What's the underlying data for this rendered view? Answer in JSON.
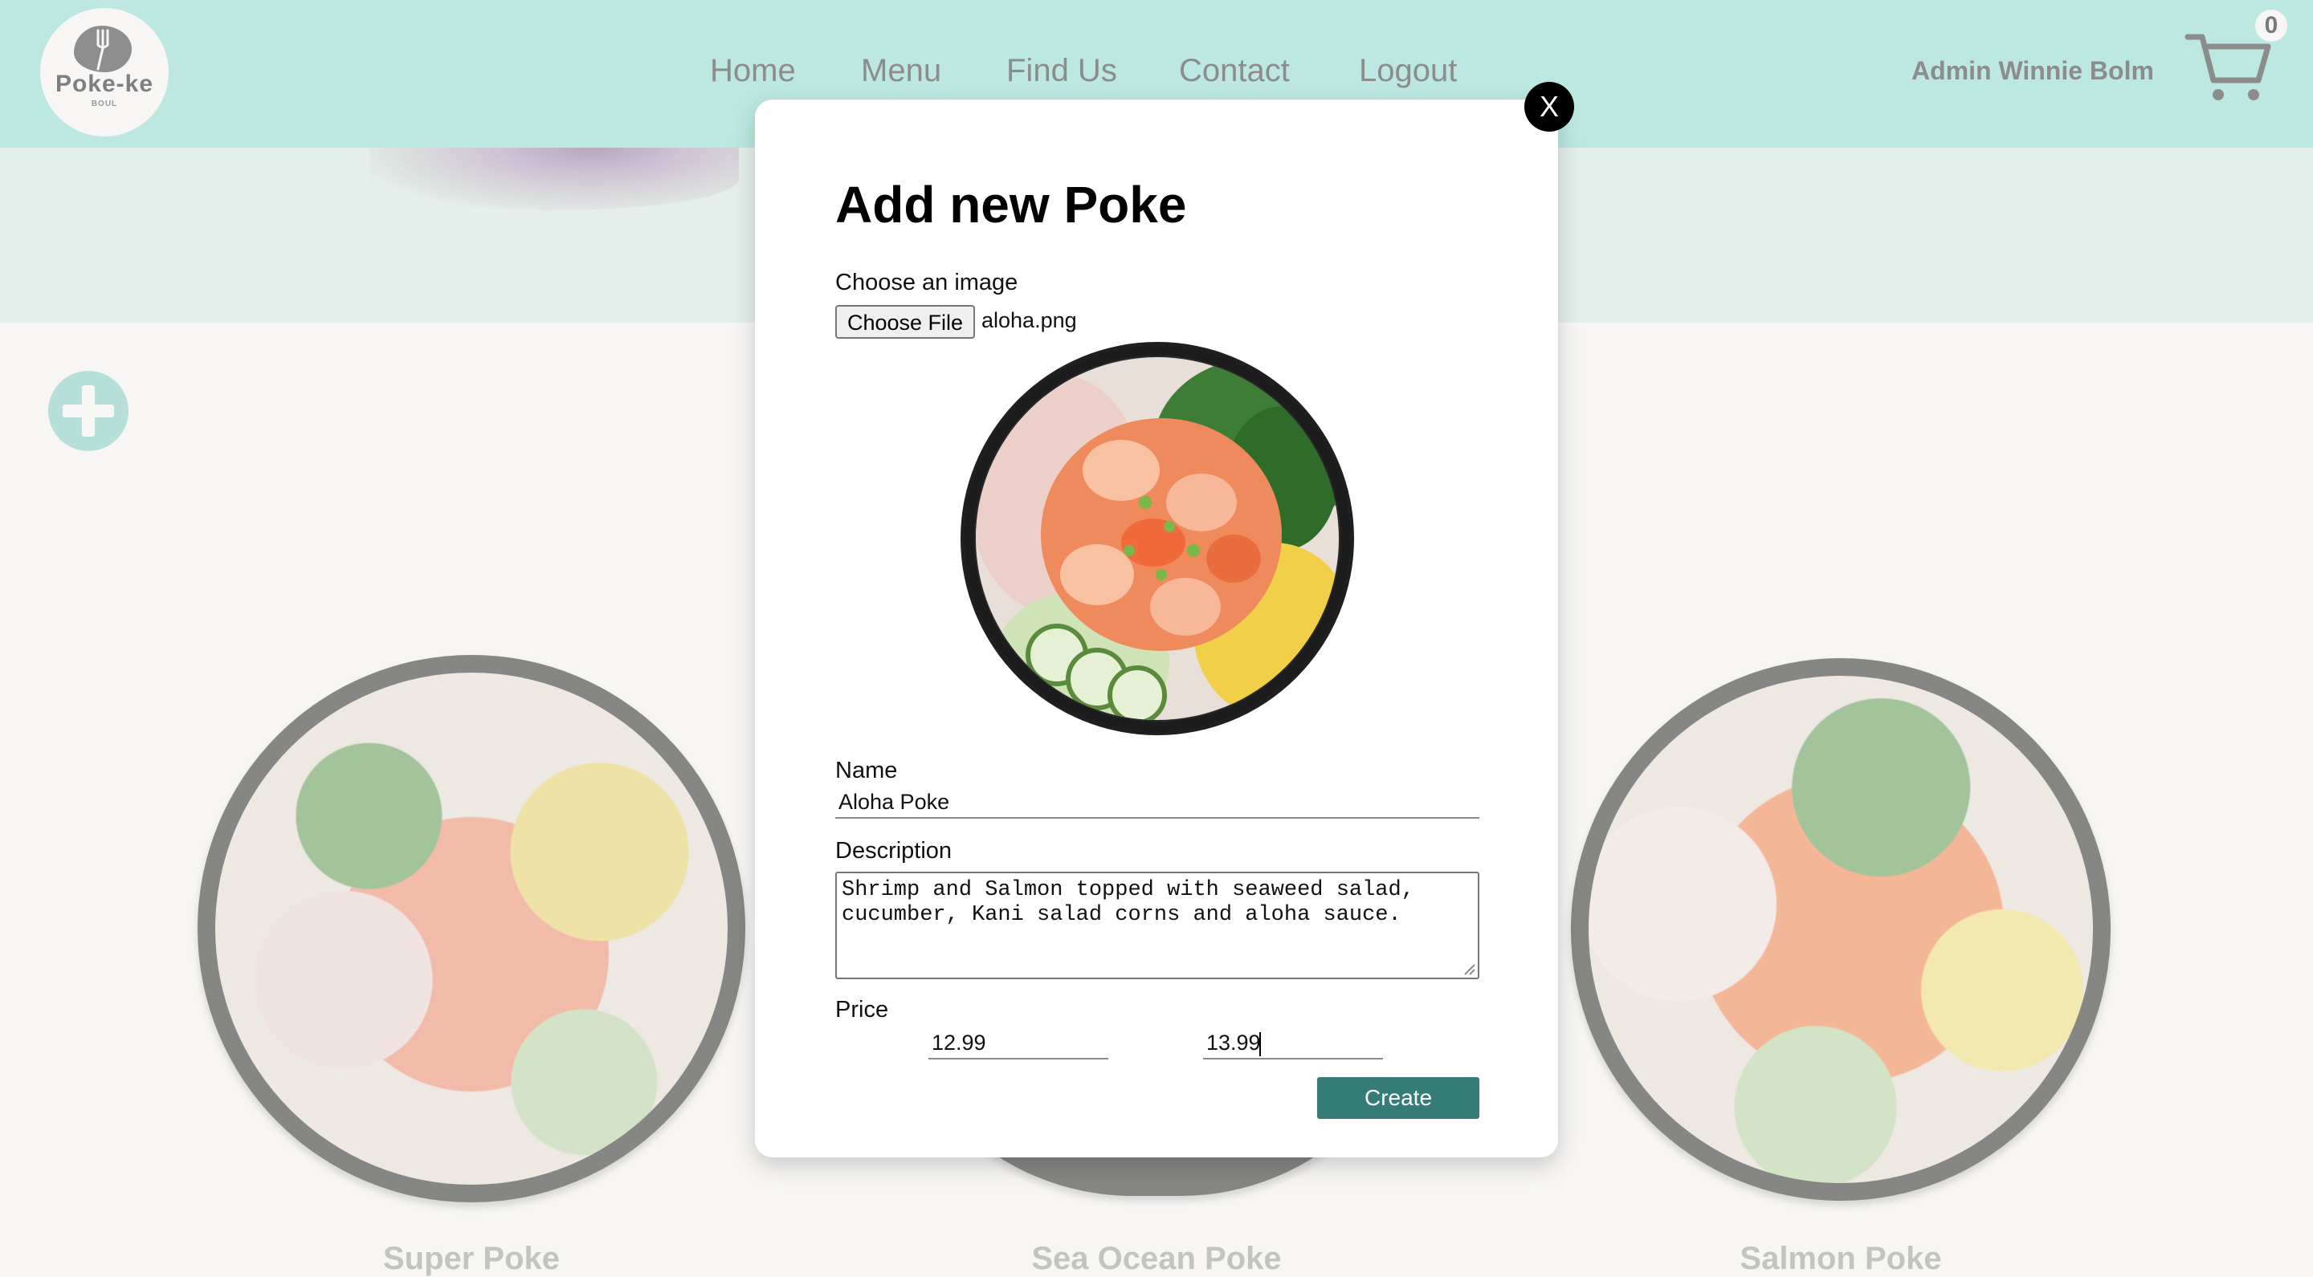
{
  "header": {
    "logo": {
      "text": "Poke-ke",
      "subtext": "BOUL"
    },
    "nav": [
      "Home",
      "Menu",
      "Find Us",
      "Contact",
      "Logout"
    ],
    "admin_name": "Admin Winnie Bolm",
    "cart_count": "0",
    "background_color": "#bce8e1"
  },
  "menu": {
    "add_icon": "plus-icon",
    "cards": [
      {
        "name": "Super Poke"
      },
      {
        "name": "Sea Ocean Poke"
      },
      {
        "name": "Salmon Poke"
      }
    ]
  },
  "modal": {
    "close_label": "X",
    "title": "Add new Poke",
    "image_label": "Choose an image",
    "file_button_label": "Choose File",
    "file_name": "aloha.png",
    "name_label": "Name",
    "name_value": "Aloha Poke",
    "description_label": "Description",
    "description_value": "Shrimp and Salmon topped with seaweed salad, cucumber, Kani salad corns and aloha sauce.",
    "price_label": "Price",
    "price_1": "12.99",
    "price_2": "13.99",
    "create_label": "Create",
    "accent_color": "#357c78"
  }
}
